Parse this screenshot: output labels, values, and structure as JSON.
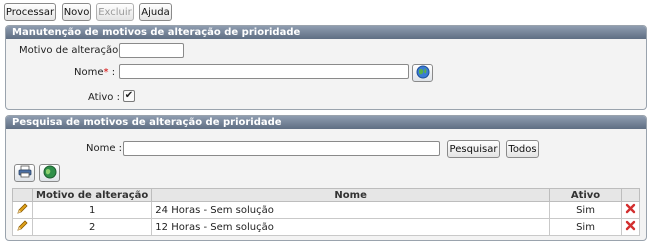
{
  "toolbar": {
    "processar": "Processar",
    "novo": "Novo",
    "excluir": "Excluir",
    "ajuda": "Ajuda"
  },
  "form_panel": {
    "title": "Manutenção de motivos de alteração de prioridade",
    "motivo_label": "Motivo de alteração :",
    "motivo_value": "",
    "nome_label": "Nome",
    "nome_required": "*",
    "nome_colon": ":",
    "nome_value": "",
    "ativo_label": "Ativo :",
    "ativo_checked": true,
    "ativo_mark": "✔"
  },
  "search_panel": {
    "title": "Pesquisa de motivos de alteração de prioridade",
    "nome_label": "Nome :",
    "nome_value": "",
    "pesquisar": "Pesquisar",
    "todos": "Todos"
  },
  "table": {
    "columns": [
      "",
      "Motivo de alteração",
      "Nome",
      "Ativo",
      ""
    ],
    "rows": [
      {
        "motivo": "1",
        "nome": "24 Horas - Sem solução",
        "ativo": "Sim"
      },
      {
        "motivo": "2",
        "nome": "12 Horas - Sem solução",
        "ativo": "Sim"
      }
    ]
  },
  "icons": {
    "globe": "globe-icon",
    "print": "print-icon",
    "edit": "pencil-icon",
    "delete": "delete-x-icon"
  },
  "colors": {
    "panel_header": "#6b7a8f",
    "required": "#d40000",
    "delete": "#d32f2f",
    "pencil": "#e0a21a"
  }
}
